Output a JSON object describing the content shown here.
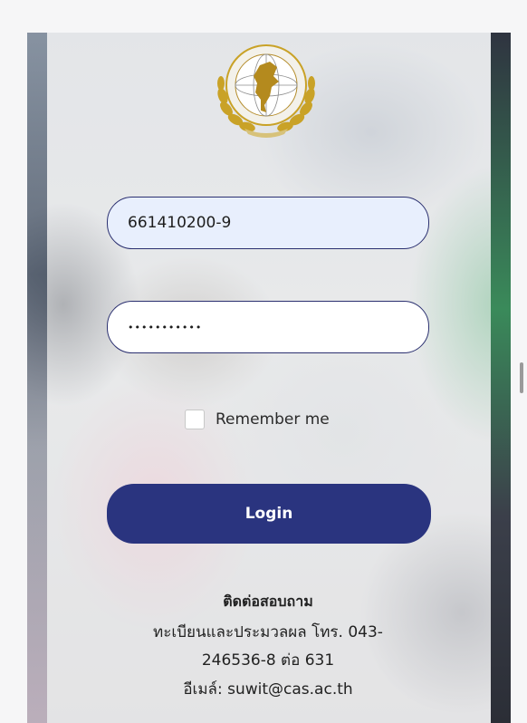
{
  "login_form": {
    "username_value": "661410200-9",
    "password_mask": "•••••••••••",
    "remember_label": "Remember me",
    "login_label": "Login"
  },
  "contact": {
    "title": "ติดต่อสอบถาม",
    "line1": "ทะเบียนและประมวลผล โทร. 043-",
    "line2": "246536-8 ต่อ 631",
    "line3": "อีเมล์: suwit@cas.ac.th"
  },
  "colors": {
    "accent": "#2a347f",
    "input_border": "#2b3070",
    "username_bg": "#e8effd",
    "logo_gold": "#c9a227"
  },
  "icons": {
    "logo": "college-seal-logo"
  }
}
